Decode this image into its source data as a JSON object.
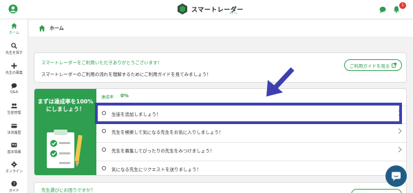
{
  "header": {
    "logo_text": "スマートレーダー",
    "logo_beta": "BETA",
    "notification_count": "1"
  },
  "sidebar": {
    "items": [
      {
        "label": "ホーム",
        "icon": "home-icon",
        "active": true
      },
      {
        "label": "先生を探す",
        "icon": "search-icon"
      },
      {
        "label": "先生の募集",
        "icon": "plus-icon"
      },
      {
        "label": "Q&A",
        "icon": "chat-bubble-icon"
      },
      {
        "label": "生徒管理",
        "icon": "people-icon"
      },
      {
        "label": "決済履歴",
        "icon": "card-icon"
      },
      {
        "label": "基本情報",
        "icon": "id-card-icon"
      },
      {
        "label": "オンライン",
        "icon": "gear-icon"
      },
      {
        "label": "ガイド",
        "icon": "help-icon"
      }
    ]
  },
  "breadcrumb": {
    "label": "ホーム"
  },
  "welcome": {
    "title": "スマートレーダーをご利用いただきありがとうございます！",
    "subtitle": "スマートレーダーのご利用の流れを理解するためにご利用ガイドを見てみましょう！",
    "guide_button": "ご利用ガイドを見る"
  },
  "task": {
    "heading": "まずは達成率を100%にしましょう！",
    "progress_label": "達成率",
    "progress_value": "0%",
    "rows": [
      {
        "label": "生徒を追加しましょう！"
      },
      {
        "label": "先生を検索して気になる先生をお気に入りしましょう！"
      },
      {
        "label": "先生を募集してぴったりの先生をみつけましょう！"
      },
      {
        "label": "気になる先生にリクエストを送りましょう！"
      }
    ]
  },
  "bottom": {
    "text": "先生選びにお困りですか？"
  },
  "colors": {
    "brand_green": "#2e9e4f",
    "highlight_blue": "#3d3fb0",
    "badge_red": "#e23a3a"
  }
}
